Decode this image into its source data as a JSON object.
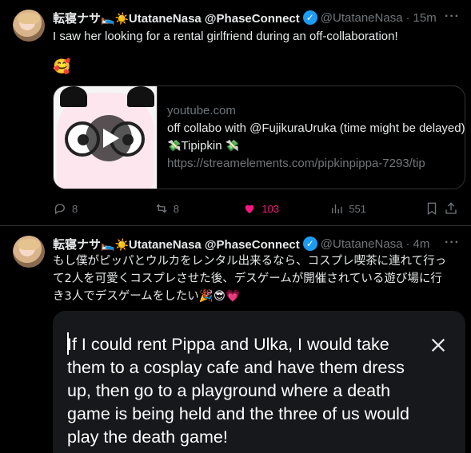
{
  "tweets": [
    {
      "display_name": "転寝ナサ",
      "emoji_bed": "🛌",
      "emoji_sun": "☀️",
      "name_suffix": "UtataneNasa @PhaseConnect",
      "verified_glyph": "✓",
      "handle": "@UtataneNasa",
      "dot": "·",
      "time": "15m",
      "more": "···",
      "text": "I saw her looking for a rental girlfriend during an off-collaboration!",
      "text_emoji": "🥰",
      "card": {
        "domain": "youtube.com",
        "title": "off collabo with @FujikuraUruka (time might be delayed)",
        "line3_prefix": "💸",
        "line3_name": "Tipipkin",
        "line3_suffix": "💸",
        "url": "https://streamelements.com/pipkinpippa-7293/tip"
      },
      "actions": {
        "replies": "8",
        "reposts": "8",
        "likes": "103",
        "views": "551"
      }
    },
    {
      "display_name": "転寝ナサ",
      "emoji_bed": "🛌",
      "emoji_sun": "☀️",
      "name_suffix": "UtataneNasa @PhaseConnect",
      "verified_glyph": "✓",
      "handle": "@UtataneNasa",
      "dot": "·",
      "time": "4m",
      "more": "···",
      "text_lines": [
        "もし僕がピッパとウルカをレンタル出来るなら、コスプレ喫茶に連れて行っ",
        "て2人を可愛くコスプレさせた後、デスゲームが開催されている遊び場に行",
        "き3人でデスゲームをしたい🎉😎💗"
      ]
    }
  ],
  "translation": {
    "text": "If I could rent Pippa and Ulka, I would take them to a cosplay cafe and have them dress up, then go to a playground where a death game is being held and the three of us would play the death game!"
  },
  "colors": {
    "accent": "#1d9bf0",
    "like": "#f91880",
    "muted": "#71767b",
    "panel": "#16181c"
  }
}
